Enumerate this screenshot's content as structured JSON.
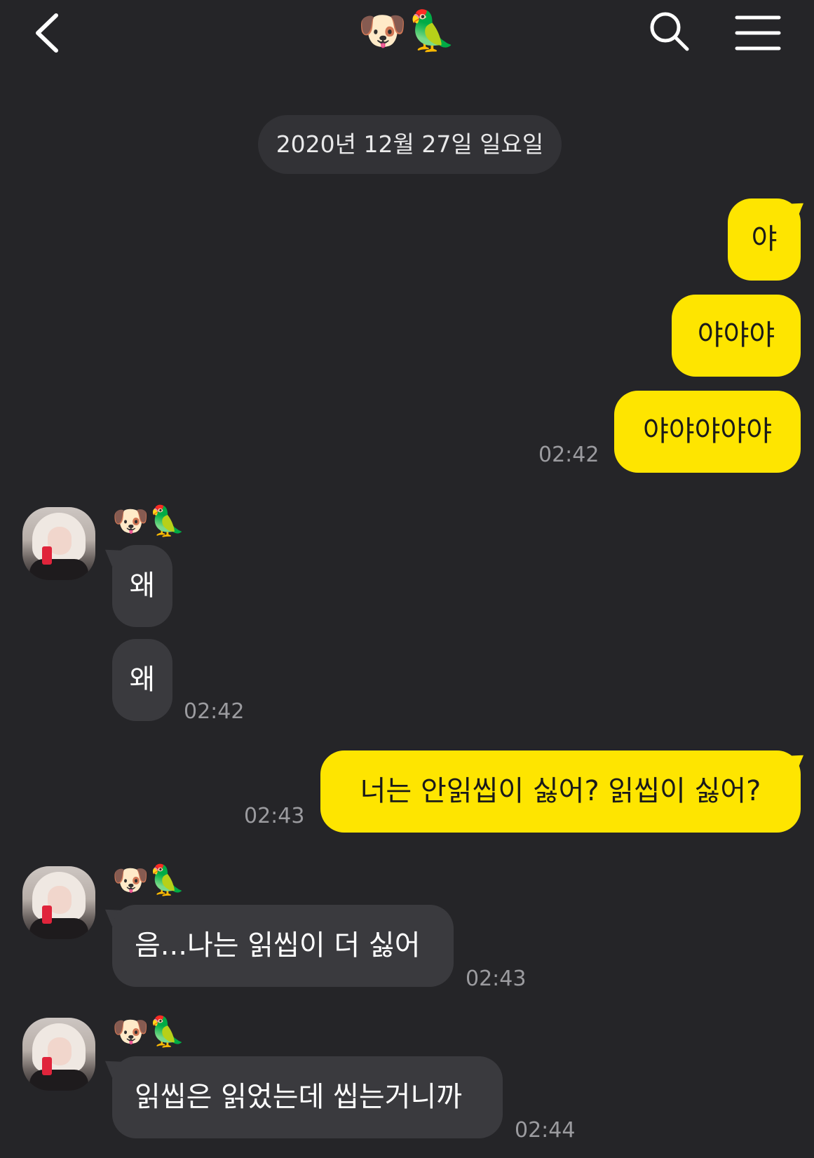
{
  "header": {
    "title": "🐶🦜",
    "back_icon": "chevron-left-icon",
    "search_icon": "search-icon",
    "menu_icon": "hamburger-menu-icon"
  },
  "date_divider": "2020년 12월 27일 일요일",
  "colors": {
    "background": "#252528",
    "my_bubble": "#fee500",
    "their_bubble": "#3a3a3e",
    "timestamp": "#9b9b9f"
  },
  "messages": [
    {
      "sender": "me",
      "text": "야"
    },
    {
      "sender": "me",
      "text": "야야야"
    },
    {
      "sender": "me",
      "text": "야야야야야",
      "time": "02:42"
    },
    {
      "sender": "them",
      "name": "🐶🦜",
      "text": "왜"
    },
    {
      "sender": "them",
      "text": "왜",
      "time": "02:42"
    },
    {
      "sender": "me",
      "text": "너는 안읽씹이 싫어? 읽씹이 싫어?",
      "time": "02:43"
    },
    {
      "sender": "them",
      "name": "🐶🦜",
      "text": "음...나는 읽씹이 더 싫어",
      "time": "02:43"
    },
    {
      "sender": "them",
      "name": "🐶🦜",
      "text": "읽씹은 읽었는데 씹는거니까",
      "time": "02:44"
    }
  ]
}
